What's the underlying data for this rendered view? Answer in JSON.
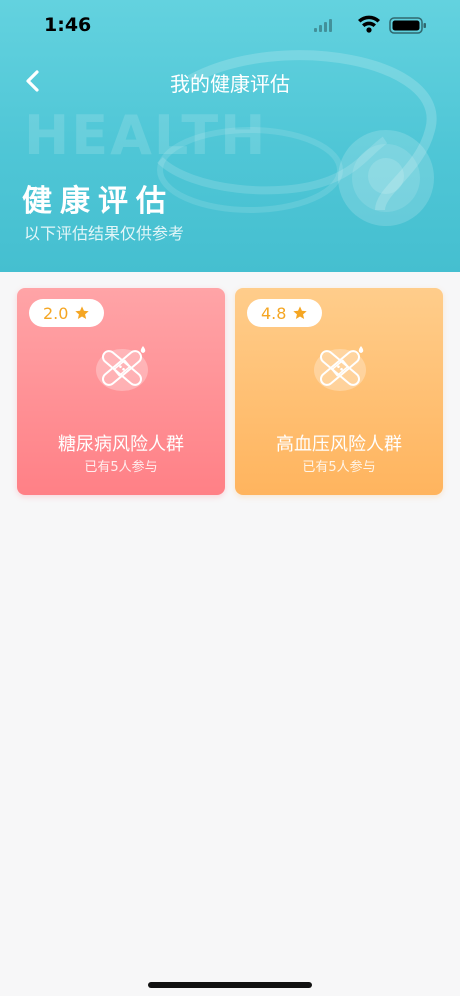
{
  "status_bar": {
    "time": "1:46"
  },
  "nav": {
    "title": "我的健康评估"
  },
  "hero": {
    "watermark": "HEALTH",
    "title": "健康评估",
    "subtitle": "以下评估结果仅供参考"
  },
  "cards": [
    {
      "rating": "2.0",
      "title": "糖尿病风险人群",
      "participants": "已有5人参与"
    },
    {
      "rating": "4.8",
      "title": "高血压风险人群",
      "participants": "已有5人参与"
    }
  ],
  "colors": {
    "hero": "#55c9d9",
    "card_diabetes": "#ff8e93",
    "card_hypertension": "#ffc070",
    "rating_text": "#f5a623"
  },
  "icons": {
    "back": "chevron-left-icon",
    "star": "star-icon",
    "card": "syringe-bandage-icon"
  }
}
